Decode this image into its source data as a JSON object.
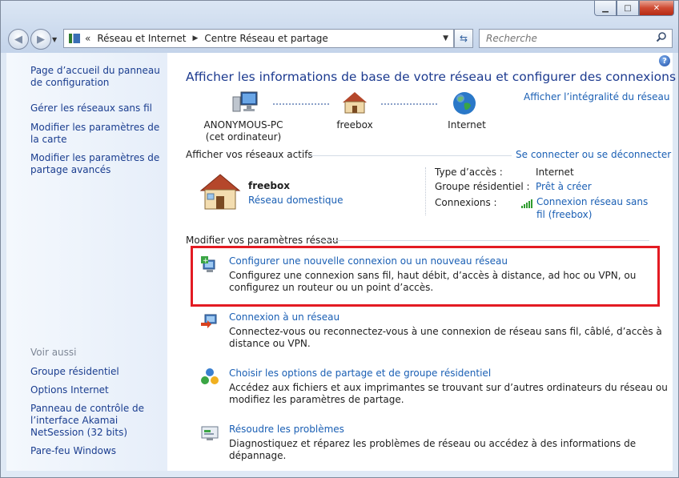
{
  "search": {
    "placeholder": "Recherche"
  },
  "address": {
    "crumb1": "Réseau et Internet",
    "crumb2": "Centre Réseau et partage"
  },
  "sidebar": {
    "items": [
      "Page d’accueil du panneau de configuration",
      "Gérer les réseaux sans fil",
      "Modifier les paramètres de la carte",
      "Modifier les paramètres de partage avancés"
    ],
    "see_also_label": "Voir aussi",
    "see_also": [
      "Groupe résidentiel",
      "Options Internet",
      "Panneau de contrôle de l’interface Akamai NetSession (32 bits)",
      "Pare-feu Windows"
    ]
  },
  "main": {
    "title": "Afficher les informations de base de votre réseau et configurer des connexions",
    "full_map_link": "Afficher l’intégralité du réseau",
    "nodes": [
      {
        "label": "ANONYMOUS-PC",
        "sublabel": "(cet ordinateur)"
      },
      {
        "label": "freebox",
        "sublabel": ""
      },
      {
        "label": "Internet",
        "sublabel": ""
      }
    ],
    "active_header": "Afficher vos réseaux actifs",
    "connect_link": "Se connecter ou se déconnecter",
    "network": {
      "name": "freebox",
      "type": "Réseau domestique"
    },
    "props": {
      "access_type_label": "Type d’accès :",
      "access_type_value": "Internet",
      "homegroup_label": "Groupe résidentiel :",
      "homegroup_value": "Prêt à créer",
      "connections_label": "Connexions :",
      "connections_value": "Connexion réseau sans fil (freebox)"
    },
    "modify_header": "Modifier vos paramètres réseau",
    "tasks": [
      {
        "link": "Configurer une nouvelle connexion ou un nouveau réseau",
        "desc": "Configurez une connexion sans fil, haut débit, d’accès à distance, ad hoc ou VPN, ou configurez un routeur ou un point d’accès."
      },
      {
        "link": "Connexion à un réseau",
        "desc": "Connectez-vous ou reconnectez-vous à une connexion de réseau sans fil, câblé, d’accès à distance ou VPN."
      },
      {
        "link": "Choisir les options de partage et de groupe résidentiel",
        "desc": "Accédez aux fichiers et aux imprimantes se trouvant sur d’autres ordinateurs du réseau ou modifiez les paramètres de partage."
      },
      {
        "link": "Résoudre les problèmes",
        "desc": "Diagnostiquez et réparez les problèmes de réseau ou accédez à des informations de dépannage."
      }
    ]
  }
}
